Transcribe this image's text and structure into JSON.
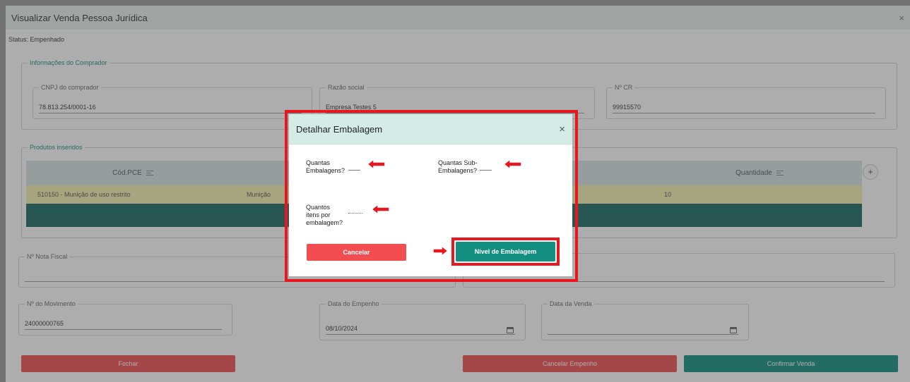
{
  "page": {
    "title": "Visualizar Venda Pessoa Jurídica",
    "close": "×",
    "status": "Status: Empenhado"
  },
  "comprador": {
    "legend": "Informações do Comprador",
    "cnpj_label": "CNPJ do comprador",
    "cnpj_value": "78.813.254/0001-16",
    "razao_label": "Razão social",
    "razao_value": "Empresa Testes 5",
    "cr_label": "Nº CR",
    "cr_value": "99915570"
  },
  "produtos": {
    "legend": "Produtos inseridos",
    "columns": [
      "Cód.PCE",
      "Quantidade"
    ],
    "add": "+",
    "rows": [
      {
        "cod": "510150 - Munição de uso restrito",
        "tipo": "Munição",
        "quantidade": "10"
      }
    ]
  },
  "fiscal": {
    "nota_label": "Nº Nota Fiscal"
  },
  "movimento": {
    "mov_label": "Nº do Movimento",
    "mov_value": "24000000765",
    "empenho_label": "Data do Empenho",
    "empenho_value": "08/10/2024",
    "venda_label": "Data da Venda",
    "venda_value": ""
  },
  "footer_buttons": {
    "fechar": "Fechar",
    "cancelar_empenho": "Cancelar Empenho",
    "confirmar_venda": "Confirmar Venda"
  },
  "modal": {
    "title": "Detalhar Embalagem",
    "close": "×",
    "q_embalagens": "Quantas Embalagens?",
    "q_sub": "Quantas Sub-Embalagens?",
    "q_itens": "Quantos itens por embalagem?",
    "cancel": "Cancelar",
    "level": "Nível de Embalagem"
  },
  "colors": {
    "accent": "#128f80",
    "danger": "#f24e52",
    "highlight": "#e8161e",
    "row_highlight": "#f3f1b0",
    "modal_header": "#d5ece6"
  },
  "icons": [
    "sort-icon",
    "calendar-icon",
    "close-icon",
    "plus-icon",
    "left-arrow-icon",
    "right-arrow-icon"
  ]
}
